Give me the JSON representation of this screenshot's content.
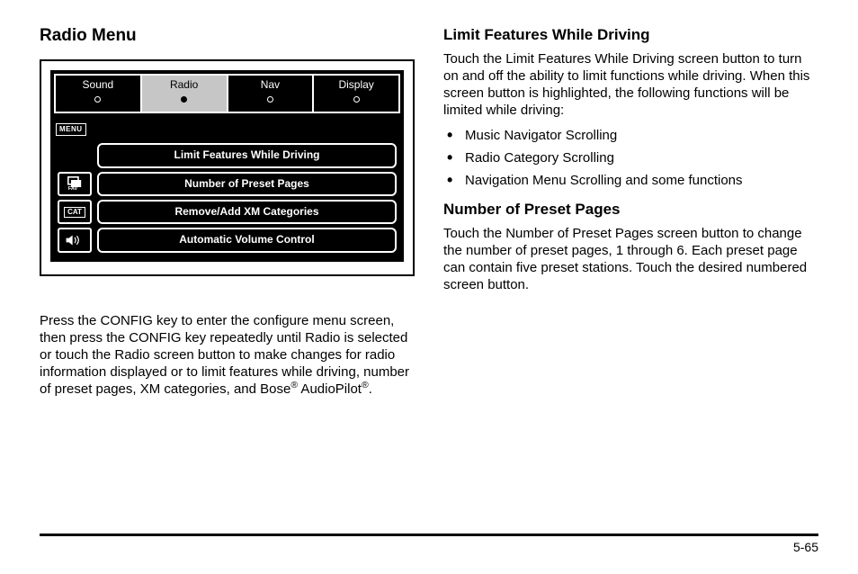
{
  "left": {
    "heading": "Radio Menu",
    "screen": {
      "tabs": [
        "Sound",
        "Radio",
        "Nav",
        "Display"
      ],
      "selected_tab_index": 1,
      "menu_badge": "MENU",
      "rows": [
        {
          "icon": "",
          "label": "Limit Features While Driving"
        },
        {
          "icon": "FAV",
          "label": "Number of Preset Pages"
        },
        {
          "icon": "CAT",
          "label": "Remove/Add XM Categories"
        },
        {
          "icon": "VOL",
          "label": "Automatic Volume Control"
        }
      ]
    },
    "para_pre": "Press the CONFIG key to enter the configure menu screen, then press the CONFIG key repeatedly until Radio is selected or touch the Radio screen button to make changes for radio information displayed or to limit features while driving, number of preset pages, XM categories, and Bose",
    "para_mid": " AudioPilot",
    "para_end": "."
  },
  "right": {
    "section1_heading": "Limit Features While Driving",
    "section1_para": "Touch the Limit Features While Driving screen button to turn on and off the ability to limit functions while driving. When this screen button is highlighted, the following functions will be limited while driving:",
    "section1_bullets": [
      "Music Navigator Scrolling",
      "Radio Category Scrolling",
      "Navigation Menu Scrolling and some functions"
    ],
    "section2_heading": "Number of Preset Pages",
    "section2_para": "Touch the Number of Preset Pages screen button to change the number of preset pages, 1 through 6. Each preset page can contain five preset stations. Touch the desired numbered screen button."
  },
  "page_number": "5-65",
  "reg_mark": "®"
}
